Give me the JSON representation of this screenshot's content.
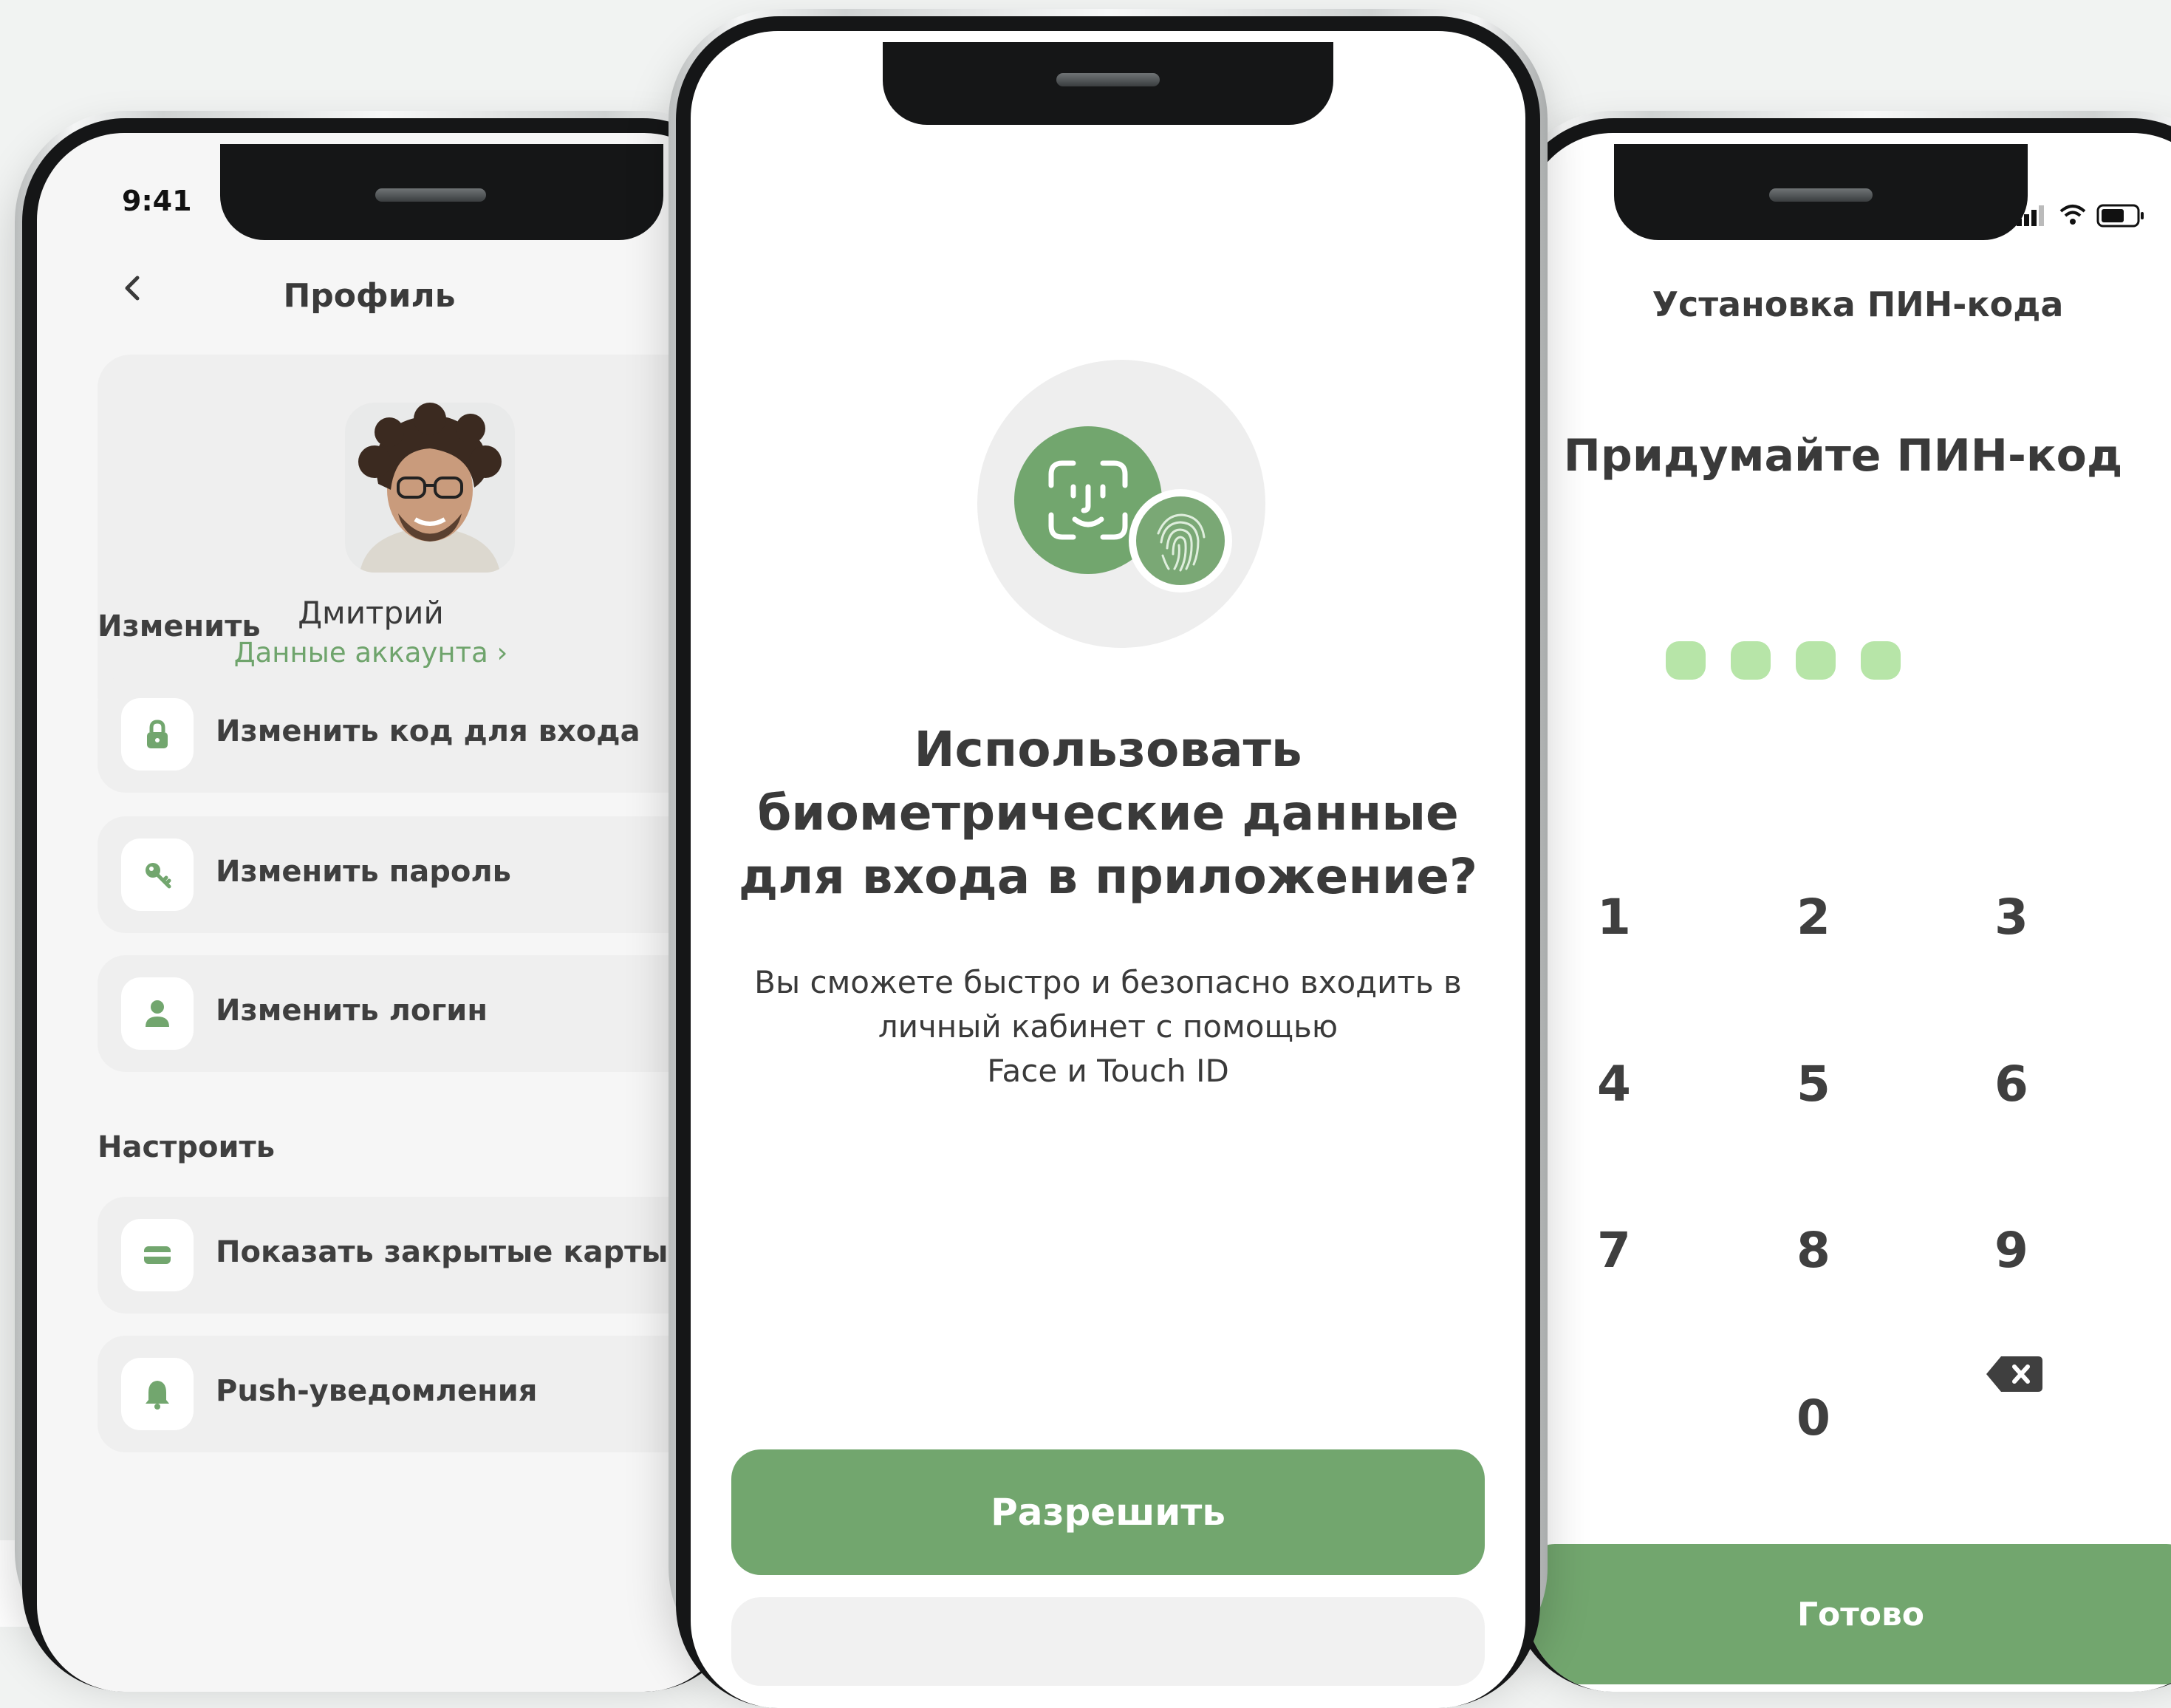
{
  "colors": {
    "accent": "#72a66e",
    "pin_dot": "#b7e5a8",
    "link": "#6fa46c",
    "background": "#f1f3f2"
  },
  "left_phone": {
    "status_time": "9:41",
    "title": "Профиль",
    "user": {
      "name": "Дмитрий",
      "account_link": "Данные аккаунта ›"
    },
    "section_change": "Изменить",
    "change_items": [
      {
        "label": "Изменить код для входа",
        "icon": "lock-icon"
      },
      {
        "label": "Изменить пароль",
        "icon": "key-icon"
      },
      {
        "label": "Изменить логин",
        "icon": "user-icon"
      }
    ],
    "section_settings": "Настроить",
    "settings_items": [
      {
        "label": "Показать закрытые карты",
        "icon": "card-icon",
        "toggle_on": true
      },
      {
        "label": "Push-уведомления",
        "icon": "bell-icon",
        "toggle_on": true
      }
    ]
  },
  "middle_phone": {
    "title": "Использовать биометрические данные для входа в приложение?",
    "description_line1": "Вы сможете быстро и безопасно входить в",
    "description_line2": "личный кабинет с помощью",
    "description_line3": "Face и Touch ID",
    "allow_button": "Разрешить",
    "icons": [
      "face-id-icon",
      "fingerprint-icon"
    ]
  },
  "right_phone": {
    "header": "Установка ПИН-кода",
    "prompt": "Придумайте ПИН-код",
    "pin_dots": 4,
    "keys": [
      "1",
      "2",
      "3",
      "4",
      "5",
      "6",
      "7",
      "8",
      "9",
      "0"
    ],
    "backspace_icon": "backspace-icon",
    "done_button": "Готово"
  }
}
